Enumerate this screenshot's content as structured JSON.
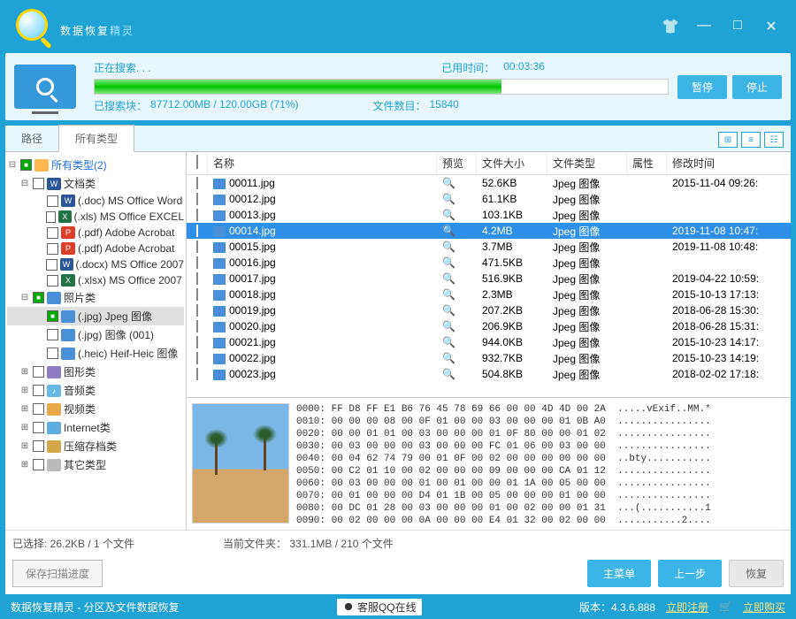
{
  "app": {
    "title_main": "数据恢复",
    "title_accent": "精灵"
  },
  "progress": {
    "searching_label": "正在搜索. . .",
    "elapsed_label": "已用时间：",
    "elapsed_value": "00:03:36",
    "searched_label": "已搜索块：",
    "searched_value": "87712.00MB / 120.00GB (71%)",
    "file_count_label": "文件数目：",
    "file_count_value": "15840",
    "pause_btn": "暂停",
    "stop_btn": "停止",
    "percent": 71
  },
  "tabs": {
    "path": "路径",
    "all_types": "所有类型"
  },
  "tree": {
    "root": "所有类型(2)",
    "docs": "文档类",
    "doc": "(.doc) MS Office Word",
    "xls": "(.xls) MS Office EXCEL",
    "pdf": "(.pdf) Adobe Acrobat",
    "pdf2": "(.pdf) Adobe Acrobat",
    "docx": "(.docx) MS Office 2007",
    "xlsx": "(.xlsx) MS Office 2007",
    "photos": "照片类",
    "jpg": "(.jpg) Jpeg 图像",
    "jpg2": "(.jpg) 图像 (001)",
    "heic": "(.heic) Heif-Heic 图像",
    "shapes": "图形类",
    "audio": "音频类",
    "video": "视频类",
    "internet": "Internet类",
    "archive": "压缩存档类",
    "other": "其它类型"
  },
  "columns": {
    "name": "名称",
    "preview": "预览",
    "size": "文件大小",
    "type": "文件类型",
    "attr": "属性",
    "mtime": "修改时间"
  },
  "files": [
    {
      "name": "00011.jpg",
      "size": "52.6KB",
      "type": "Jpeg 图像",
      "time": "2015-11-04 09:26:"
    },
    {
      "name": "00012.jpg",
      "size": "61.1KB",
      "type": "Jpeg 图像",
      "time": ""
    },
    {
      "name": "00013.jpg",
      "size": "103.1KB",
      "type": "Jpeg 图像",
      "time": ""
    },
    {
      "name": "00014.jpg",
      "size": "4.2MB",
      "type": "Jpeg 图像",
      "time": "2019-11-08 10:47:",
      "selected": true
    },
    {
      "name": "00015.jpg",
      "size": "3.7MB",
      "type": "Jpeg 图像",
      "time": "2019-11-08 10:48:"
    },
    {
      "name": "00016.jpg",
      "size": "471.5KB",
      "type": "Jpeg 图像",
      "time": ""
    },
    {
      "name": "00017.jpg",
      "size": "516.9KB",
      "type": "Jpeg 图像",
      "time": "2019-04-22 10:59:"
    },
    {
      "name": "00018.jpg",
      "size": "2.3MB",
      "type": "Jpeg 图像",
      "time": "2015-10-13 17:13:"
    },
    {
      "name": "00019.jpg",
      "size": "207.2KB",
      "type": "Jpeg 图像",
      "time": "2018-06-28 15:30:"
    },
    {
      "name": "00020.jpg",
      "size": "206.9KB",
      "type": "Jpeg 图像",
      "time": "2018-06-28 15:31:"
    },
    {
      "name": "00021.jpg",
      "size": "944.0KB",
      "type": "Jpeg 图像",
      "time": "2015-10-23 14:17:"
    },
    {
      "name": "00022.jpg",
      "size": "932.7KB",
      "type": "Jpeg 图像",
      "time": "2015-10-23 14:19:"
    },
    {
      "name": "00023.jpg",
      "size": "504.8KB",
      "type": "Jpeg 图像",
      "time": "2018-02-02 17:18:"
    }
  ],
  "hex": "0000: FF D8 FF E1 B6 76 45 78 69 66 00 00 4D 4D 00 2A  .....vExif..MM.*\n0010: 00 00 00 08 00 0F 01 00 00 03 00 00 00 01 0B A0  ................\n0020: 00 00 01 01 00 03 00 00 00 01 0F 80 00 00 01 02  ................\n0030: 00 03 00 00 00 03 00 00 00 FC 01 06 00 03 00 00  ................\n0040: 00 04 62 74 79 00 01 0F 00 02 00 00 00 00 00 00  ..bty...........\n0050: 00 C2 01 10 00 02 00 00 00 09 00 00 00 CA 01 12  ................\n0060: 00 03 00 00 00 01 00 01 00 00 01 1A 00 05 00 00  ................\n0070: 00 01 00 00 00 D4 01 1B 00 05 00 00 00 01 00 00  ................\n0080: 00 DC 01 28 00 03 00 00 00 01 00 02 00 00 01 31  ...(...........1\n0090: 00 02 00 00 00 0A 00 00 00 E4 01 32 00 02 00 00  ...........2....",
  "status": {
    "selected": "已选择: 26.2KB / 1 个文件",
    "folder": "当前文件夹： 331.1MB / 210 个文件",
    "save_progress": "保存扫描进度",
    "main_menu": "主菜单",
    "prev": "上一步",
    "recover": "恢复"
  },
  "footer": {
    "left": "数据恢复精灵 - 分区及文件数据恢复",
    "qq": "客服QQ在线",
    "version_label": "版本：",
    "version": "4.3.6.888",
    "register": "立即注册",
    "buy": "立即购买"
  }
}
